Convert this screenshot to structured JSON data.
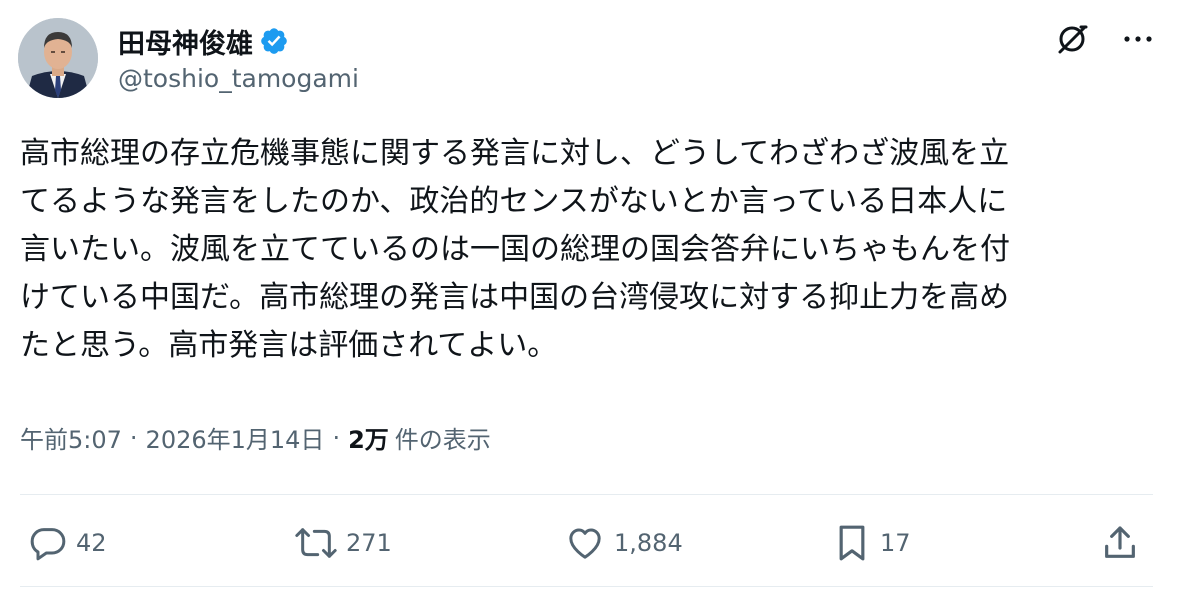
{
  "user": {
    "display_name": "田母神俊雄",
    "handle": "@toshio_tamogami",
    "verified": true
  },
  "tweet": {
    "text": "高市総理の存立危機事態に関する発言に対し、どうしてわざわざ波風を立\nてるような発言をしたのか、政治的センスがないとか言っている日本人に\n言いたい。波風を立てているのは一国の総理の国会答弁にいちゃもんを付\nけている中国だ。高市総理の発言は中国の台湾侵攻に対する抑止力を高め\nたと思う。高市発言は評価されてよい。"
  },
  "meta": {
    "time": "午前5:07",
    "separator": "·",
    "date": "2026年1月14日",
    "views_count": "2万",
    "views_label": "件の表示"
  },
  "actions": {
    "replies": "42",
    "reposts": "271",
    "likes": "1,884",
    "bookmarks": "17"
  },
  "colors": {
    "text": "#0f1419",
    "muted": "#536471",
    "verified": "#1d9bf0",
    "divider": "#e6ecf0"
  },
  "icons": [
    "grok-icon",
    "more-icon",
    "reply-icon",
    "repost-icon",
    "like-icon",
    "bookmark-icon",
    "share-icon",
    "verified-badge-icon"
  ]
}
